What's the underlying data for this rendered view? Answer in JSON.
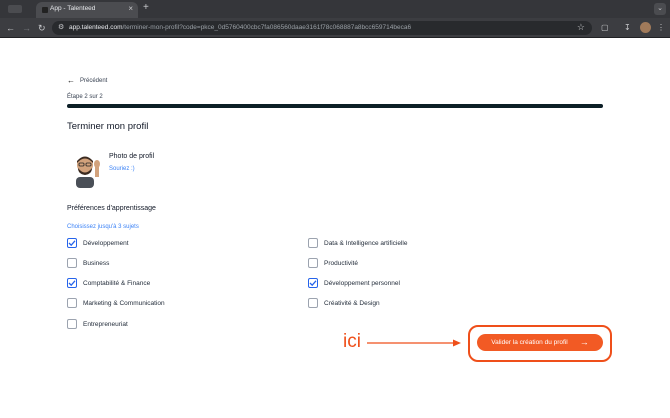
{
  "browser": {
    "tab_title": "App - Talenteed",
    "tab_close": "×",
    "new_tab": "+",
    "url_host": "app.talenteed.com",
    "url_path": "/terminer-mon-profil?code=pkce_0d5760400cbc7fa086560daae3161f78c068887a8bcc659714beca6"
  },
  "page": {
    "back_label": "Précédent",
    "step_label": "Étape 2 sur 2",
    "progress": 1.0,
    "title": "Terminer mon profil",
    "photo_title": "Photo de profil",
    "photo_sub": "Souriez :)",
    "preferences_title": "Préférences d'apprentissage",
    "preferences_hint": "Choisissez jusqu'à 3 sujets",
    "options_left": [
      {
        "label": "Développement",
        "checked": true
      },
      {
        "label": "Business",
        "checked": false
      },
      {
        "label": "Comptabilité & Finance",
        "checked": true
      },
      {
        "label": "Marketing & Communication",
        "checked": false
      },
      {
        "label": "Entrepreneuriat",
        "checked": false
      }
    ],
    "options_right": [
      {
        "label": "Data & Intelligence artificielle",
        "checked": false
      },
      {
        "label": "Productivité",
        "checked": false
      },
      {
        "label": "Développement personnel",
        "checked": true
      },
      {
        "label": "Créativité & Design",
        "checked": false
      }
    ],
    "submit_label": "Valider la création du profil"
  },
  "annotation": {
    "text": "ici"
  },
  "colors": {
    "accent": "#f25a24",
    "annotation": "#ef4f1a",
    "checkbox": "#2563eb",
    "progress": "#0c1f26"
  }
}
